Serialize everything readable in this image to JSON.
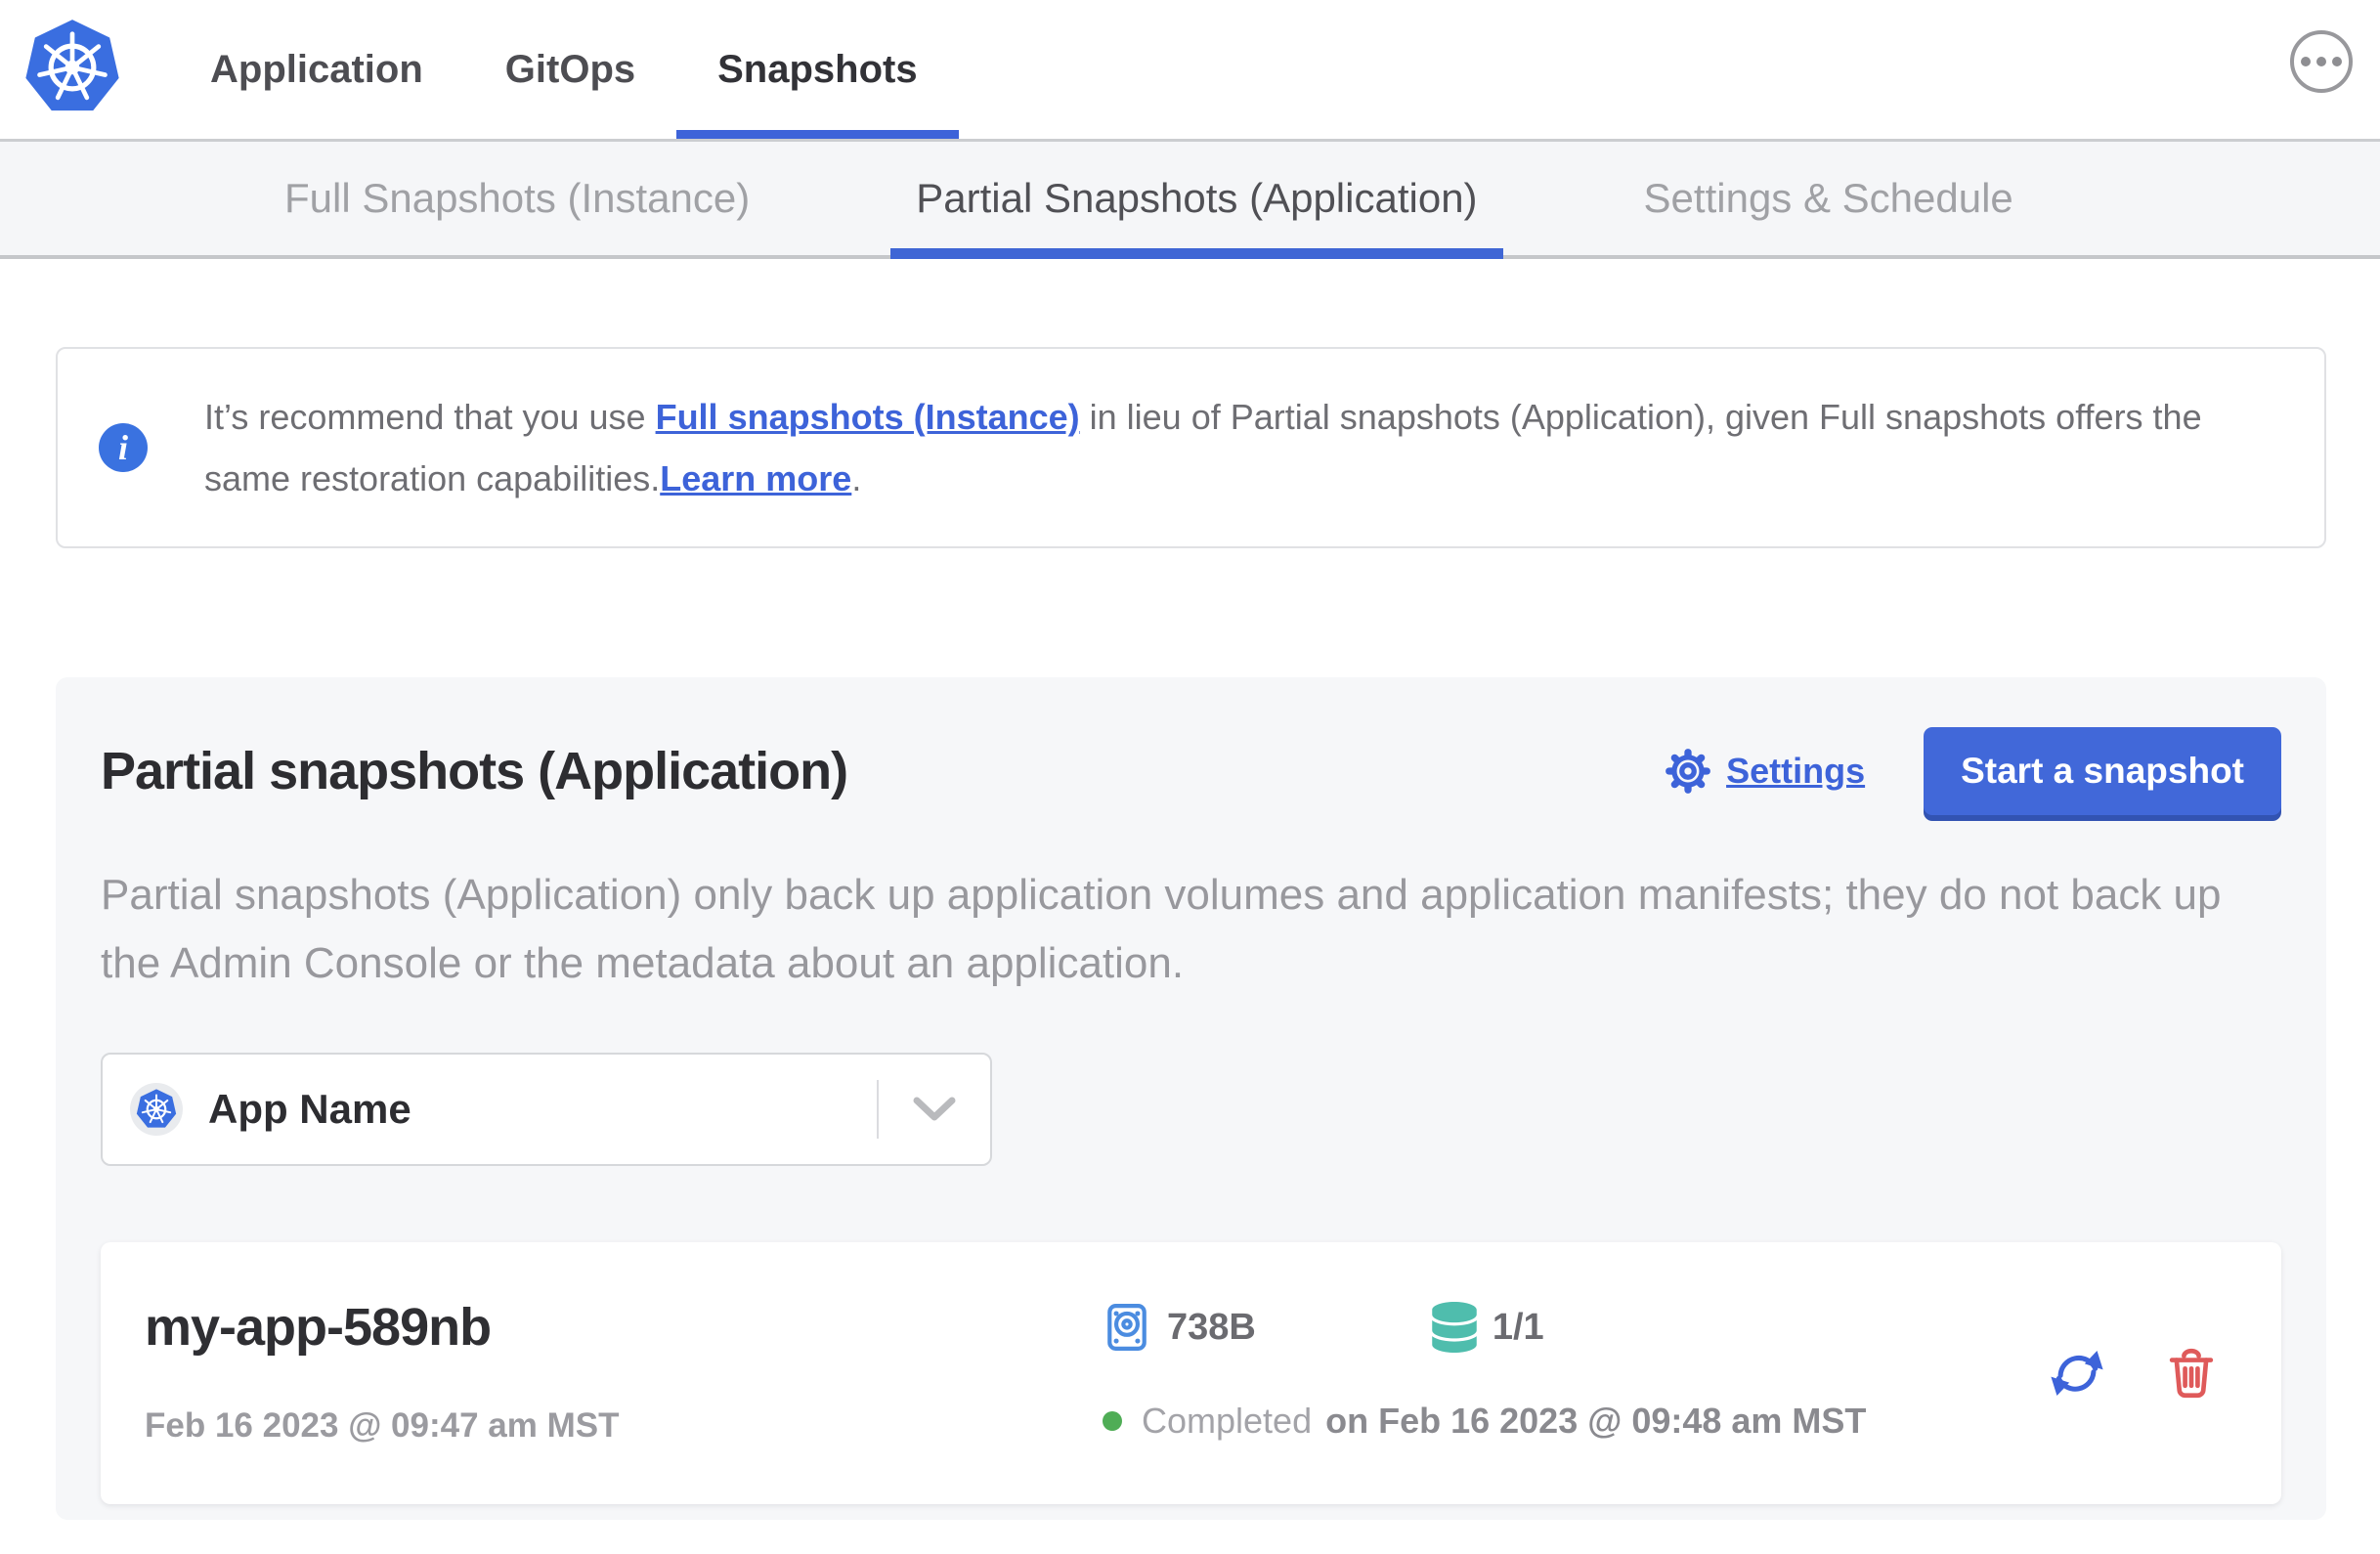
{
  "colors": {
    "accent_blue": "#3d63d9",
    "button_blue": "#4168d9",
    "logo_blue": "#3a6ee0",
    "disk_icon_blue": "#4b8ce0",
    "volume_teal": "#4fbdad",
    "status_green": "#4fad56",
    "delete_red": "#df5a5a"
  },
  "header": {
    "tabs": [
      "Application",
      "GitOps",
      "Snapshots"
    ],
    "active_tab": "Snapshots"
  },
  "subnav": {
    "tabs": [
      "Full Snapshots (Instance)",
      "Partial Snapshots (Application)",
      "Settings & Schedule"
    ],
    "active_tab": "Partial Snapshots (Application)"
  },
  "banner": {
    "text_start": "It’s recommend that you use ",
    "link_full_snapshots": "Full snapshots (Instance)",
    "text_middle": " in lieu of Partial snapshots (Application), given Full snapshots offers the same restoration capabilities.",
    "link_learn_more": "Learn more",
    "text_end": "."
  },
  "main": {
    "title": "Partial snapshots (Application)",
    "settings_link": "Settings",
    "start_snapshot_button": "Start a snapshot",
    "description": "Partial snapshots (Application) only back up application volumes and application manifests; they do not back up the Admin Console or the metadata about an application.",
    "app_selector": {
      "value": "App Name"
    },
    "snapshots": [
      {
        "name": "my-app-589nb",
        "started_at": "Feb 16 2023 @ 09:47 am MST",
        "size": "738B",
        "volumes": "1/1",
        "status": "Completed",
        "finished_at": "on Feb 16 2023 @ 09:48 am MST"
      }
    ]
  }
}
